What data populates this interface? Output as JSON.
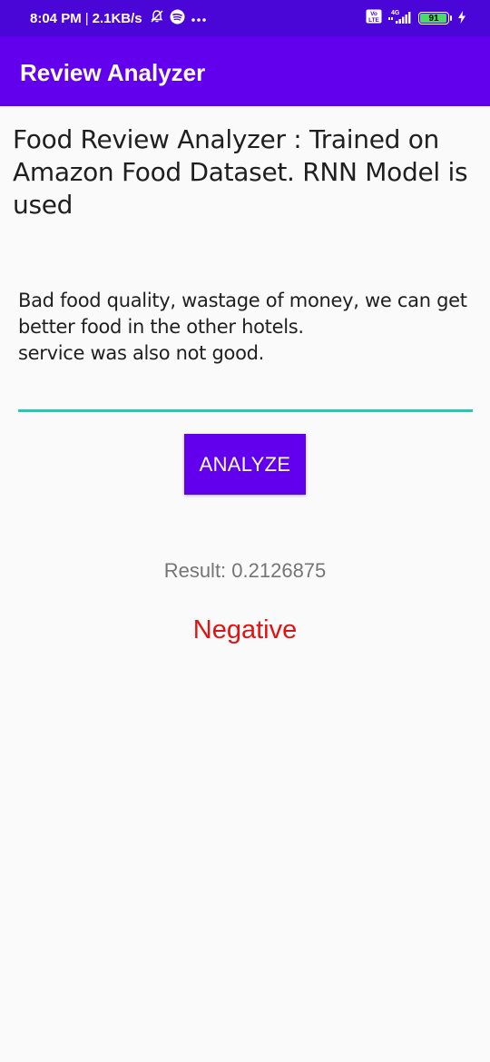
{
  "status_bar": {
    "time": "8:04 PM",
    "network_speed": "2.1KB/s",
    "separator": "|",
    "network_type": "4G",
    "volte_label": "Vo LTE",
    "battery_level": "91",
    "icons": [
      "mute-notification-icon",
      "spotify-icon",
      "more-dots-icon",
      "volte-icon",
      "signal-icon",
      "battery-icon",
      "charging-icon"
    ]
  },
  "app_bar": {
    "title": "Review Analyzer",
    "color": "#6200ee"
  },
  "main": {
    "heading": "Food Review Analyzer : Trained on Amazon Food Dataset. RNN Model is used",
    "review_input": {
      "value": "Bad food quality, wastage of money, we can get better food in the other hotels.\nservice was also not good."
    },
    "analyze_button_label": "ANALYZE",
    "result_text": "Result: 0.2126875",
    "sentiment_label": "Negative"
  },
  "colors": {
    "accent": "#6200ee",
    "status_bar": "#4a06d6",
    "input_underline": "#26c6b8",
    "negative": "#e31212"
  }
}
